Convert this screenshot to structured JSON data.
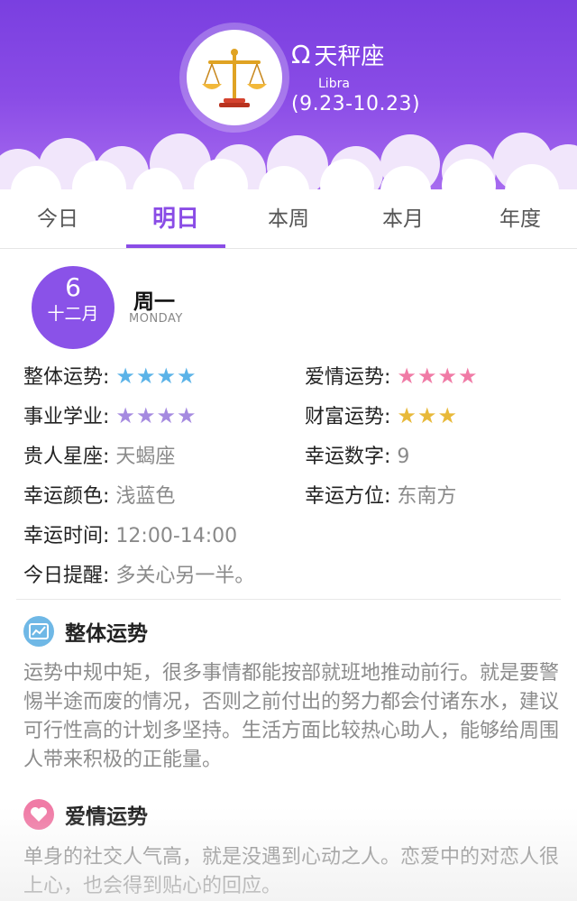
{
  "sign": {
    "symbol": "Ω",
    "name": "天秤座",
    "english": "Libra",
    "date_range": "(9.23-10.23)"
  },
  "tabs": [
    {
      "label": "今日",
      "active": false
    },
    {
      "label": "明日",
      "active": true
    },
    {
      "label": "本周",
      "active": false
    },
    {
      "label": "本月",
      "active": false
    },
    {
      "label": "年度",
      "active": false
    }
  ],
  "date": {
    "day": "6",
    "month": "十二月",
    "weekday": "周一",
    "weekday_en": "MONDAY"
  },
  "fortune": {
    "overall": {
      "label": "整体运势:",
      "stars": 4,
      "color": "#5bb3e8"
    },
    "love": {
      "label": "爱情运势:",
      "stars": 4,
      "color": "#f07ba6"
    },
    "career": {
      "label": "事业学业:",
      "stars": 4,
      "color": "#a58ae0"
    },
    "wealth": {
      "label": "财富运势:",
      "stars": 3,
      "color": "#e8b93a"
    },
    "noble_label": "贵人星座:",
    "noble_value": "天蝎座",
    "number_label": "幸运数字:",
    "number_value": "9",
    "color_label": "幸运颜色:",
    "color_value": "浅蓝色",
    "direction_label": "幸运方位:",
    "direction_value": "东南方",
    "time_label": "幸运时间:",
    "time_value": "12:00-14:00",
    "tip_label": "今日提醒:",
    "tip_value": "多关心另一半。"
  },
  "sections": {
    "overall": {
      "title": "整体运势",
      "icon": "chart-trend-icon",
      "icon_color": "#6fb8e6",
      "body": "运势中规中矩，很多事情都能按部就班地推动前行。就是要警惕半途而废的情况，否则之前付出的努力都会付诸东水，建议可行性高的计划多坚持。生活方面比较热心助人，能够给周围人带来积极的正能量。"
    },
    "love": {
      "title": "爱情运势",
      "icon": "heart-icon",
      "icon_color": "#f07ba6",
      "body": "单身的社交人气高，就是没遇到心动之人。恋爱中的对恋人很上心，也会得到贴心的回应。"
    }
  }
}
